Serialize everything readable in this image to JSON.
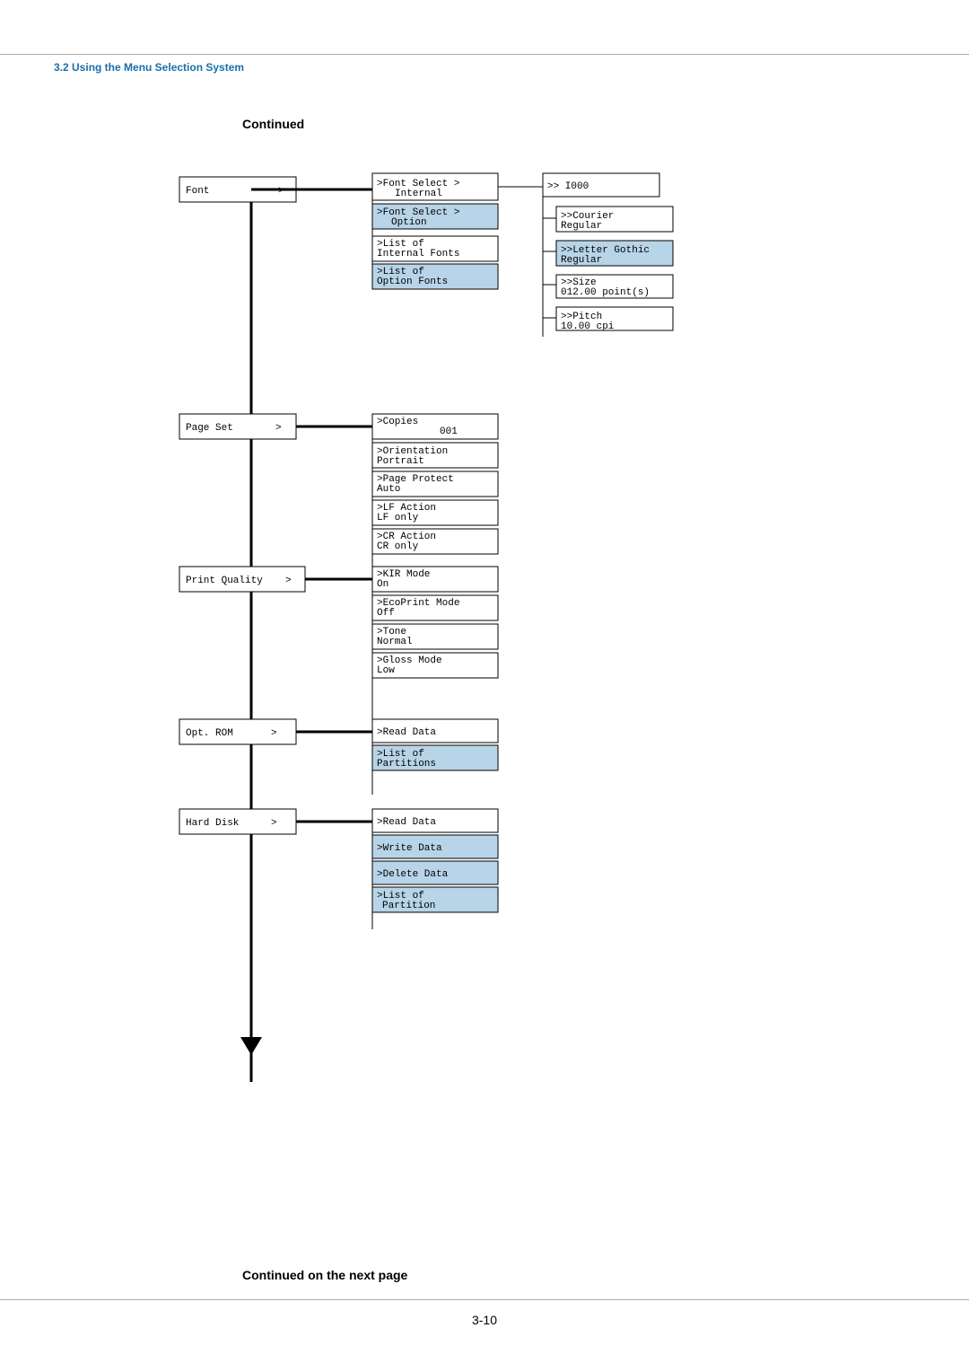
{
  "page": {
    "section_title": "3.2 Using the Menu Selection System",
    "continued_top": "Continued",
    "continued_bottom": "Continued on the next page",
    "page_number": "3-10"
  },
  "nodes": {
    "font": "Font",
    "font_arrow": ">",
    "font_select_internal": ">Font Select >\n Internal",
    "font_select_option": ">Font Select >\n Option",
    "list_internal": ">List of\n Internal Fonts",
    "list_option": ">List of\n Option Fonts",
    "i1000": ">> I000",
    "courier": ">>Courier\n Regular",
    "letter_gothic": ">>Letter Gothic\n Regular",
    "size": ">>Size\n 012.00 point(s)",
    "pitch": ">>Pitch\n     10.00 cpi",
    "page_set": "Page Set",
    "page_set_arrow": ">",
    "copies": ">Copies\n           001",
    "orientation": ">Orientation\n Portrait",
    "page_protect": ">Page Protect\n Auto",
    "lf_action": ">LF Action\n LF only",
    "cr_action": ">CR Action\n CR only",
    "print_quality": "Print Quality",
    "print_quality_arrow": ">",
    "kir_mode": ">KIR Mode\n On",
    "ecoprint": ">EcoPrint Mode\n Off",
    "tone": ">Tone\n Normal",
    "gloss_mode": ">Gloss Mode\n Low",
    "opt_rom": "Opt. ROM",
    "opt_rom_arrow": ">",
    "read_data_opt": ">Read Data",
    "list_partitions": ">List of\n Partitions",
    "hard_disk": "Hard Disk",
    "hard_disk_arrow": ">",
    "read_data_hd": ">Read Data",
    "write_data": ">Write Data",
    "delete_data": ">Delete Data",
    "list_partition": ">List of\n Partition"
  }
}
